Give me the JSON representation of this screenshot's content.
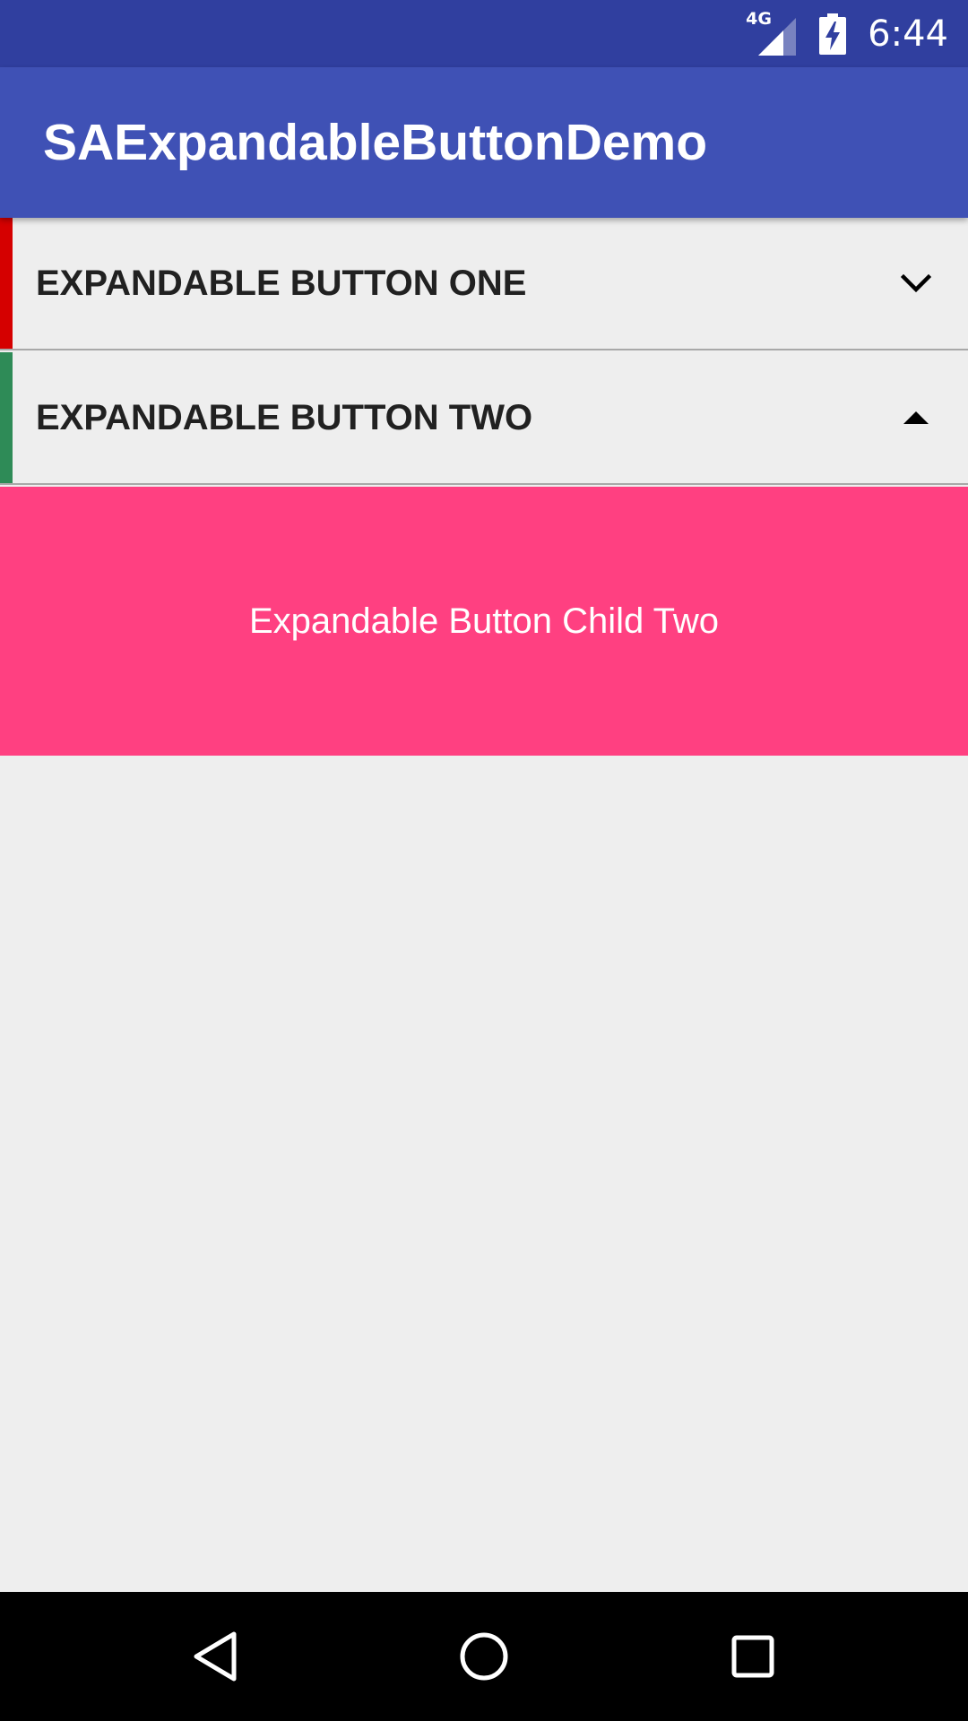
{
  "status_bar": {
    "network_label": "4G",
    "time": "6:44",
    "background": "#303F9F",
    "icons": [
      "signal-icon",
      "battery-charging-icon"
    ]
  },
  "app_bar": {
    "title": "SAExpandableButtonDemo",
    "background": "#3F51B5"
  },
  "expandable_buttons": [
    {
      "label": "EXPANDABLE BUTTON ONE",
      "accent_color": "#D50000",
      "expanded": false,
      "indicator_icon": "chevron-down-icon"
    },
    {
      "label": "EXPANDABLE BUTTON TWO",
      "accent_color": "#2E8B57",
      "expanded": true,
      "indicator_icon": "caret-up-icon"
    }
  ],
  "child_panel": {
    "text": "Expandable Button Child Two",
    "background": "#FF4081"
  },
  "nav_bar": {
    "buttons": [
      "back-icon",
      "home-icon",
      "recents-icon"
    ]
  }
}
